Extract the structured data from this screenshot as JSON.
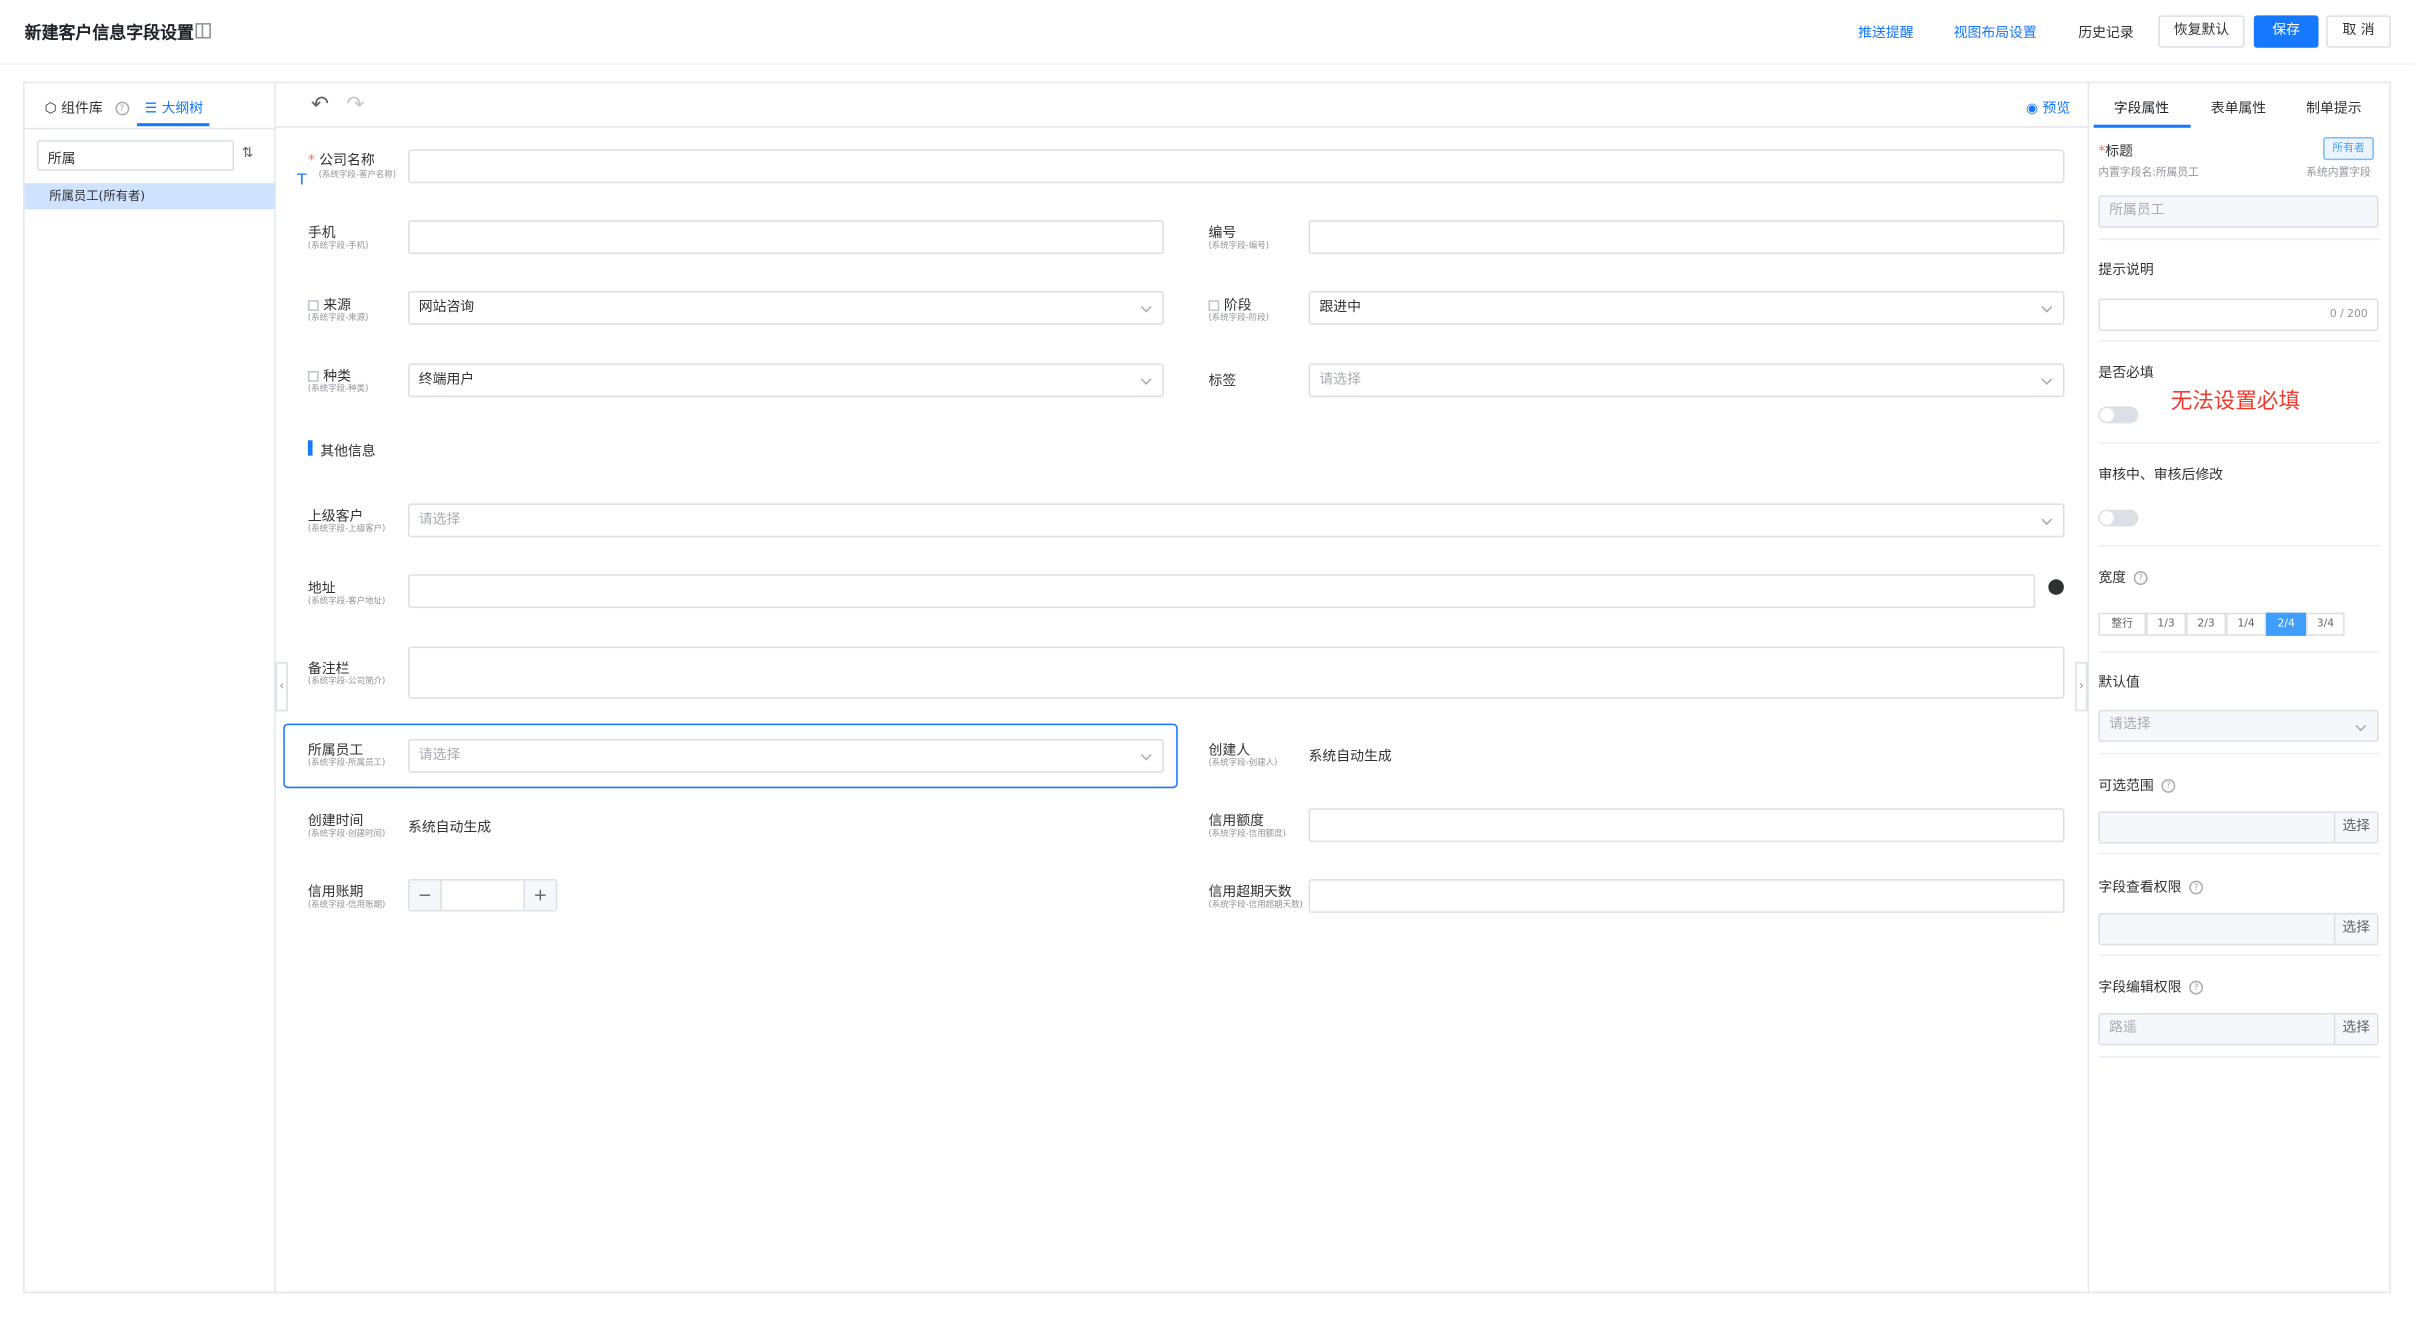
{
  "header": {
    "title": "新建客户信息字段设置",
    "links": [
      "推送提醒",
      "视图布局设置"
    ],
    "history": "历史记录",
    "restore": "恢复默认",
    "save": "保存",
    "cancel": "取 消"
  },
  "left_panel": {
    "tabs": [
      "组件库",
      "大纲树"
    ],
    "search_value": "所属",
    "tree_item": "所属员工(所有者)"
  },
  "canvas": {
    "preview": "预览",
    "section_title": "其他信息",
    "fields": {
      "company": {
        "label": "公司名称",
        "sub": "(系统字段-客户名称)"
      },
      "phone": {
        "label": "手机",
        "sub": "(系统字段-手机)"
      },
      "number": {
        "label": "编号",
        "sub": "(系统字段-编号)"
      },
      "source": {
        "label": "来源",
        "sub": "(系统字段-来源)",
        "value": "网站咨询"
      },
      "stage": {
        "label": "阶段",
        "sub": "(系统字段-阶段)",
        "value": "跟进中"
      },
      "kind": {
        "label": "种类",
        "sub": "(系统字段-种类)",
        "value": "终端用户"
      },
      "tags": {
        "label": "标签",
        "placeholder": "请选择"
      },
      "parent": {
        "label": "上级客户",
        "sub": "(系统字段-上级客户)",
        "placeholder": "请选择"
      },
      "address": {
        "label": "地址",
        "sub": "(系统字段-客户地址)"
      },
      "remark": {
        "label": "备注栏",
        "sub": "(系统字段-公司简介)"
      },
      "owner": {
        "label": "所属员工",
        "sub": "(系统字段-所属员工)",
        "placeholder": "请选择"
      },
      "creator": {
        "label": "创建人",
        "sub": "(系统字段-创建人)",
        "value": "系统自动生成"
      },
      "created": {
        "label": "创建时间",
        "sub": "(系统字段-创建时间)",
        "value": "系统自动生成"
      },
      "credit_limit": {
        "label": "信用额度",
        "sub": "(系统字段-信用额度)"
      },
      "credit_term": {
        "label": "信用账期",
        "sub": "(系统字段-信用账期)"
      },
      "credit_overdue": {
        "label": "信用超期天数",
        "sub": "(系统字段-信用超期天数)"
      }
    }
  },
  "right_panel": {
    "tabs": [
      "字段属性",
      "表单属性",
      "制单提示"
    ],
    "title_label": "标题",
    "owner_tag": "所有者",
    "builtin_name": "内置字段名:所属员工",
    "builtin_type": "系统内置字段",
    "title_value": "所属员工",
    "hint_label": "提示说明",
    "hint_count": "0 / 200",
    "required_label": "是否必填",
    "annotation": "无法设置必填",
    "audit_label": "审核中、审核后修改",
    "width_label": "宽度",
    "width_options": [
      "整行",
      "1/3",
      "2/3",
      "1/4",
      "2/4",
      "3/4"
    ],
    "width_selected": "2/4",
    "default_label": "默认值",
    "default_placeholder": "请选择",
    "range_label": "可选范围",
    "view_perm_label": "字段查看权限",
    "edit_perm_label": "字段编辑权限",
    "edit_perm_value": "路遥",
    "select_btn": "选择"
  }
}
